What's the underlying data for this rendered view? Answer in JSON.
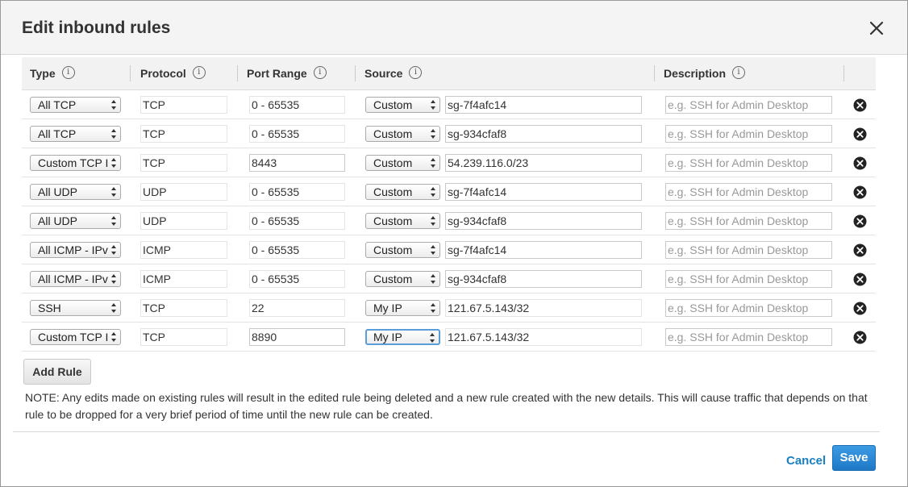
{
  "dialog": {
    "title": "Edit inbound rules",
    "close_icon": "close-icon"
  },
  "table": {
    "headers": {
      "type": "Type",
      "protocol": "Protocol",
      "port_range": "Port Range",
      "source": "Source",
      "description": "Description"
    },
    "info_glyph": "i",
    "rules": [
      {
        "type": "All TCP",
        "protocol": "TCP",
        "port_range": "0 - 65535",
        "source_type": "Custom",
        "source": "sg-7f4afc14",
        "description_placeholder": "e.g. SSH for Admin Desktop"
      },
      {
        "type": "All TCP",
        "protocol": "TCP",
        "port_range": "0 - 65535",
        "source_type": "Custom",
        "source": "sg-934cfaf8",
        "description_placeholder": "e.g. SSH for Admin Desktop"
      },
      {
        "type": "Custom TCP I",
        "protocol": "TCP",
        "port_range": "8443",
        "source_type": "Custom",
        "source": "54.239.116.0/23",
        "description_placeholder": "e.g. SSH for Admin Desktop"
      },
      {
        "type": "All UDP",
        "protocol": "UDP",
        "port_range": "0 - 65535",
        "source_type": "Custom",
        "source": "sg-7f4afc14",
        "description_placeholder": "e.g. SSH for Admin Desktop"
      },
      {
        "type": "All UDP",
        "protocol": "UDP",
        "port_range": "0 - 65535",
        "source_type": "Custom",
        "source": "sg-934cfaf8",
        "description_placeholder": "e.g. SSH for Admin Desktop"
      },
      {
        "type": "All ICMP - IPv",
        "protocol": "ICMP",
        "port_range": "0 - 65535",
        "source_type": "Custom",
        "source": "sg-7f4afc14",
        "description_placeholder": "e.g. SSH for Admin Desktop"
      },
      {
        "type": "All ICMP - IPv",
        "protocol": "ICMP",
        "port_range": "0 - 65535",
        "source_type": "Custom",
        "source": "sg-934cfaf8",
        "description_placeholder": "e.g. SSH for Admin Desktop"
      },
      {
        "type": "SSH",
        "protocol": "TCP",
        "port_range": "22",
        "source_type": "My IP",
        "source": "121.67.5.143/32",
        "description_placeholder": "e.g. SSH for Admin Desktop"
      },
      {
        "type": "Custom TCP I",
        "protocol": "TCP",
        "port_range": "8890",
        "source_type": "My IP",
        "source": "121.67.5.143/32",
        "description_placeholder": "e.g. SSH for Admin Desktop"
      }
    ]
  },
  "add_rule_label": "Add Rule",
  "note": "NOTE: Any edits made on existing rules will result in the edited rule being deleted and a new rule created with the new details. This will cause traffic that depends on that rule to be dropped for a very brief period of time until the new rule can be created.",
  "footer": {
    "cancel_label": "Cancel",
    "save_label": "Save"
  },
  "colors": {
    "link": "#1a7fc1",
    "primary": "#2a86d0",
    "focus_ring": "#5b9dd9"
  }
}
